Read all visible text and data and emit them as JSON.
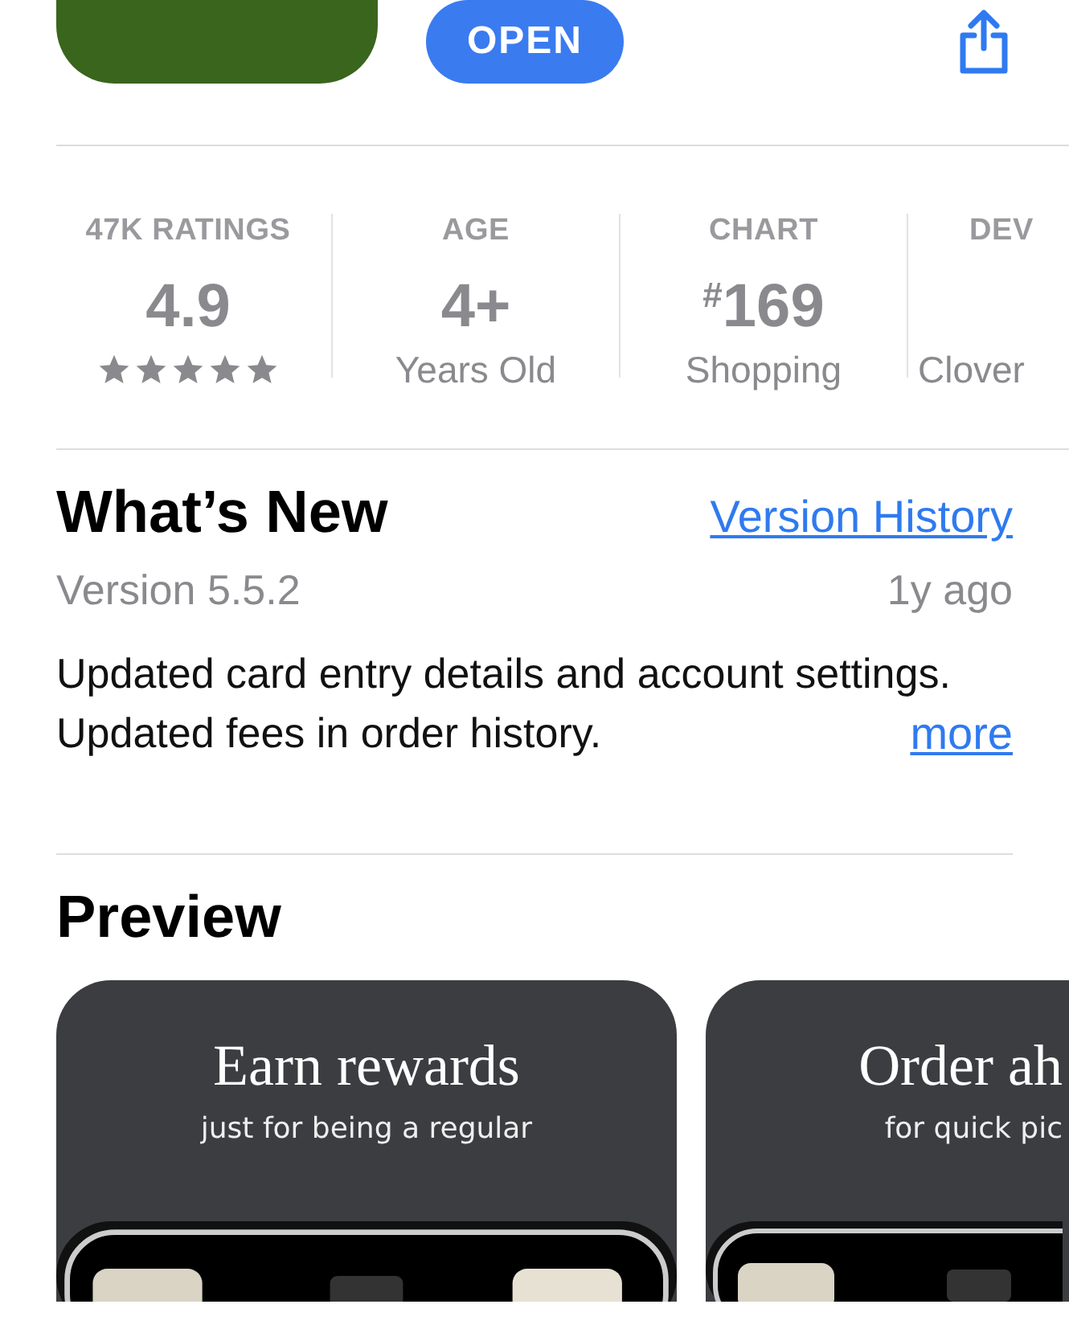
{
  "header": {
    "open_button": "OPEN"
  },
  "stats": [
    {
      "kind": "rating",
      "label": "47K RATINGS",
      "value": "4.9",
      "stars": 5
    },
    {
      "kind": "text",
      "label": "AGE",
      "value": "4+",
      "caption": "Years Old"
    },
    {
      "kind": "chart",
      "label": "CHART",
      "prefix": "#",
      "value": "169",
      "caption": "Shopping"
    },
    {
      "kind": "text",
      "label": "DEV",
      "caption": "Clover"
    }
  ],
  "whats_new": {
    "title": "What’s New",
    "link": "Version History",
    "version": "Version 5.5.2",
    "age": "1y ago",
    "notes": [
      "Updated card entry details and account settings.",
      "Updated fees in order history."
    ],
    "more": "more"
  },
  "preview": {
    "title": "Preview",
    "cards": [
      {
        "title": "Earn rewards",
        "subtitle": "just for being a regular"
      },
      {
        "title": "Order ah",
        "subtitle": "for quick pic"
      }
    ]
  }
}
